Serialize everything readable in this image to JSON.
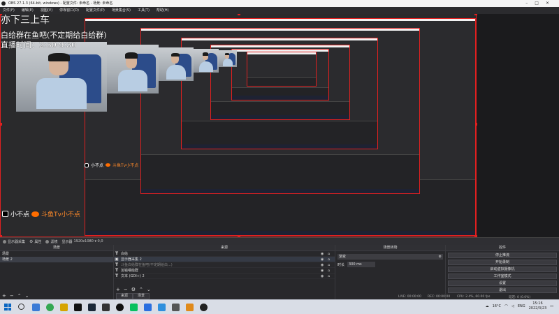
{
  "window": {
    "title": "OBS 27.1.3 (64-bit, windows) - 配置文件: 未命名 - 场景: 未命名"
  },
  "menu": {
    "items": [
      "文件(F)",
      "编辑(E)",
      "视图(V)",
      "停靠窗口(D)",
      "配置文件(P)",
      "场景集合(S)",
      "工具(T)",
      "帮助(H)"
    ]
  },
  "overlay": {
    "title": "亦下三上车",
    "line1": "白给群在鱼吧(不定期给白给群)",
    "line2": "直播时间：2:30-9:30",
    "sticker_name": "小不点",
    "sticker_tag": "斗鱼Tv小不点"
  },
  "tabstrip": {
    "tab1": "显示器采集",
    "props": "属性",
    "filters": "滤镜",
    "display_label": "显示器",
    "display_value": "1920x1080 ▾ 0,0"
  },
  "scenes": {
    "header": "场景",
    "items": [
      "场景",
      "场景 2"
    ]
  },
  "sources": {
    "header": "来源",
    "items": [
      {
        "type": "T",
        "name": "白给",
        "hl": false,
        "dim": false
      },
      {
        "type": "▣",
        "name": "显示器采集 2",
        "hl": true,
        "dim": false
      },
      {
        "type": "T",
        "name": "斗鱼白给群在鱼吧(不定期给白...)",
        "hl": false,
        "dim": true
      },
      {
        "type": "T",
        "name": "加钱喂给群",
        "hl": false,
        "dim": false
      },
      {
        "type": "T",
        "name": "文本 (GDI+) 2",
        "hl": false,
        "dim": false
      }
    ],
    "tab_a": "来源",
    "tab_b": "场景"
  },
  "mixer": {
    "header": "场景转场",
    "transition": "渐变",
    "duration_label": "时长",
    "duration_value": "300 ms"
  },
  "controls": {
    "header": "控件",
    "buttons": [
      "停止推流",
      "开始录制",
      "启动虚拟摄像机",
      "工作室模式",
      "设置",
      "退出"
    ]
  },
  "status": {
    "live": "LIVE: 00:00:00",
    "rec": "REC: 00:00:00",
    "cpu": "CPU: 2.4%, 60.00 fps",
    "dropped": "延迟: 0 (0.0%)"
  },
  "taskbar": {
    "weather": "16°C",
    "lang": "ENG",
    "time": "15:16",
    "date": "2022/3/23",
    "icons": [
      "search-icon",
      "widgets-icon",
      "chrome-icon",
      "game-icon",
      "qq-icon",
      "steam-icon",
      "brand-icon",
      "app-g-icon",
      "wechat-icon",
      "mail-icon",
      "check-icon",
      "app-icon",
      "note-icon",
      "obs-icon"
    ],
    "icon_colors": [
      "#333333",
      "#3b7bd6",
      "#34a853",
      "#d6a400",
      "#111111",
      "#1b2838",
      "#333333",
      "#111111",
      "#07c160",
      "#2a6fe0",
      "#2f8fdd",
      "#555555",
      "#e08a1b",
      "#222222"
    ]
  },
  "colors": {
    "accent_red": "#e02020",
    "panel": "#28282b"
  }
}
